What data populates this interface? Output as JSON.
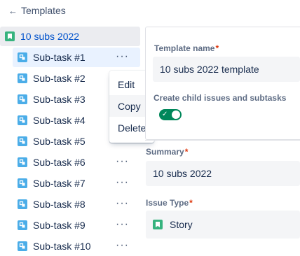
{
  "nav": {
    "back_label": "Templates"
  },
  "colors": {
    "story": "#36b37e",
    "subtask": "#4bade8",
    "accent": "#0052cc",
    "toggle_on": "#00875a",
    "required": "#de350b"
  },
  "tree": {
    "root": {
      "label": "10 subs 2022",
      "icon": "story-icon"
    },
    "subtasks": [
      {
        "label": "Sub-task #1",
        "selected": true
      },
      {
        "label": "Sub-task #2"
      },
      {
        "label": "Sub-task #3"
      },
      {
        "label": "Sub-task #4"
      },
      {
        "label": "Sub-task #5"
      },
      {
        "label": "Sub-task #6"
      },
      {
        "label": "Sub-task #7"
      },
      {
        "label": "Sub-task #8"
      },
      {
        "label": "Sub-task #9"
      },
      {
        "label": "Sub-task #10"
      }
    ],
    "more_glyph": "···"
  },
  "context_menu": {
    "items": [
      {
        "label": "Edit"
      },
      {
        "label": "Copy",
        "hovered": true
      },
      {
        "label": "Delete"
      }
    ]
  },
  "form": {
    "template_name_label": "Template name",
    "template_name_value": "10 subs 2022 template",
    "create_child_label": "Create child issues and subtasks",
    "create_child_enabled": true,
    "toggle_check": "✓",
    "summary_label": "Summary",
    "summary_value": "10 subs 2022",
    "issue_type_label": "Issue Type",
    "issue_type_value": "Story",
    "required_marker": "*"
  }
}
